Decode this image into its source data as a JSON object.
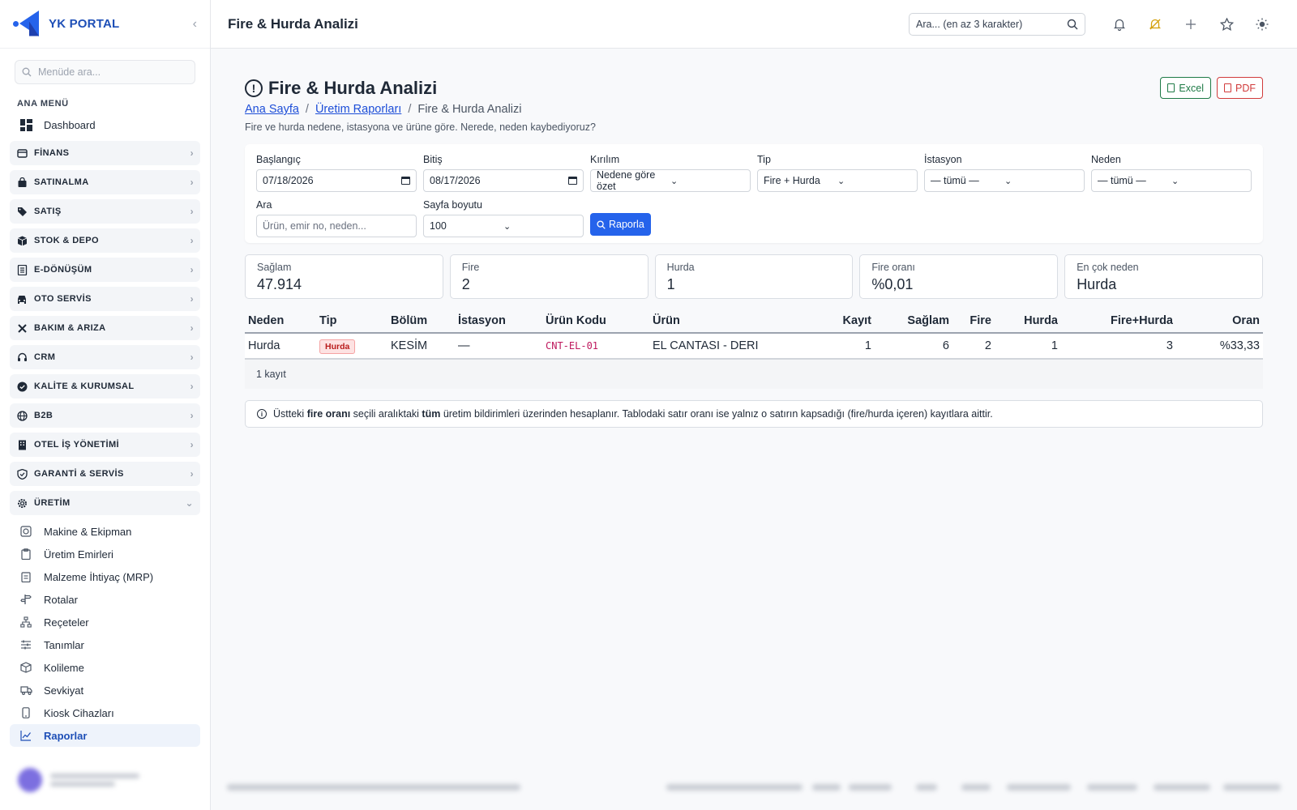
{
  "brand": {
    "name": "YK PORTAL"
  },
  "sidebar": {
    "search_placeholder": "Menüde ara...",
    "section_title": "ANA MENÜ",
    "dashboard": "Dashboard",
    "groups": [
      {
        "label": "FİNANS",
        "icon": "finance-icon"
      },
      {
        "label": "SATINALMA",
        "icon": "shopping-bag-icon"
      },
      {
        "label": "SATIŞ",
        "icon": "tag-icon"
      },
      {
        "label": "STOK & DEPO",
        "icon": "box-icon"
      },
      {
        "label": "E-DÖNÜŞÜM",
        "icon": "document-icon"
      },
      {
        "label": "OTO SERVİS",
        "icon": "car-icon"
      },
      {
        "label": "BAKIM & ARIZA",
        "icon": "tools-icon"
      },
      {
        "label": "CRM",
        "icon": "headset-icon"
      },
      {
        "label": "KALİTE & KURUMSAL",
        "icon": "badge-check-icon"
      },
      {
        "label": "B2B",
        "icon": "globe-icon"
      },
      {
        "label": "OTEL İŞ YÖNETİMİ",
        "icon": "building-icon"
      },
      {
        "label": "GARANTİ & SERVİS",
        "icon": "shield-icon"
      },
      {
        "label": "ÜRETİM",
        "icon": "gear-icon"
      }
    ],
    "uretim_items": [
      {
        "label": "Makine & Ekipman",
        "icon": "machine-icon"
      },
      {
        "label": "Üretim Emirleri",
        "icon": "clipboard-icon"
      },
      {
        "label": "Malzeme İhtiyaç (MRP)",
        "icon": "clipboard-list-icon"
      },
      {
        "label": "Rotalar",
        "icon": "signpost-icon"
      },
      {
        "label": "Reçeteler",
        "icon": "hierarchy-icon"
      },
      {
        "label": "Tanımlar",
        "icon": "sliders-icon"
      },
      {
        "label": "Kolileme",
        "icon": "package-icon"
      },
      {
        "label": "Sevkiyat",
        "icon": "truck-icon"
      },
      {
        "label": "Kiosk Cihazları",
        "icon": "tablet-icon"
      },
      {
        "label": "Raporlar",
        "icon": "chart-line-icon"
      }
    ]
  },
  "topbar": {
    "title": "Fire & Hurda Analizi",
    "search_placeholder": "Ara... (en az 3 karakter)"
  },
  "page": {
    "title": "Fire & Hurda Analizi",
    "breadcrumb": [
      "Ana Sayfa",
      "Üretim Raporları",
      "Fire & Hurda Analizi"
    ],
    "subtitle": "Fire ve hurda nedene, istasyona ve ürüne göre. Nerede, neden kaybediyoruz?",
    "excel_label": "Excel",
    "pdf_label": "PDF"
  },
  "filters": {
    "start_label": "Başlangıç",
    "start_value": "07/18/2026",
    "end_label": "Bitiş",
    "end_value": "08/17/2026",
    "breakdown_label": "Kırılım",
    "breakdown_value": "Nedene göre özet",
    "type_label": "Tip",
    "type_value": "Fire + Hurda",
    "station_label": "İstasyon",
    "station_value": "— tümü —",
    "reason_label": "Neden",
    "reason_value": "— tümü —",
    "search_label": "Ara",
    "search_placeholder": "Ürün, emir no, neden...",
    "pagesize_label": "Sayfa boyutu",
    "pagesize_value": "100",
    "report_button": "Raporla"
  },
  "kpis": [
    {
      "label": "Sağlam",
      "value": "47.914"
    },
    {
      "label": "Fire",
      "value": "2"
    },
    {
      "label": "Hurda",
      "value": "1"
    },
    {
      "label": "Fire oranı",
      "value": "%0,01"
    },
    {
      "label": "En çok neden",
      "value": "Hurda"
    }
  ],
  "table": {
    "headers": [
      "Neden",
      "Tip",
      "Bölüm",
      "İstasyon",
      "Ürün Kodu",
      "Ürün",
      "Kayıt",
      "Sağlam",
      "Fire",
      "Hurda",
      "Fire+Hurda",
      "Oran"
    ],
    "rows": [
      {
        "neden": "Hurda",
        "tip": "Hurda",
        "bolum": "KESİM",
        "istasyon": "—",
        "urun_kodu": "CNT-EL-01",
        "urun": "EL CANTASI - DERI",
        "kayit": "1",
        "saglam": "6",
        "fire": "2",
        "hurda": "1",
        "fire_hurda": "3",
        "oran": "%33,33"
      }
    ],
    "footer": "1 kayıt"
  },
  "info": {
    "p1": "Üstteki ",
    "b1": "fire oranı",
    "p2": " seçili aralıktaki ",
    "b2": "tüm",
    "p3": " üretim bildirimleri üzerinden hesaplanır. Tablodaki satır oranı ise yalnız o satırın kapsadığı (fire/hurda içeren) kayıtlara aittir."
  },
  "colors": {
    "accent": "#2563eb",
    "excel": "#1e7a46",
    "pdf": "#d13b3b",
    "tag_red": "#b91c1c"
  }
}
